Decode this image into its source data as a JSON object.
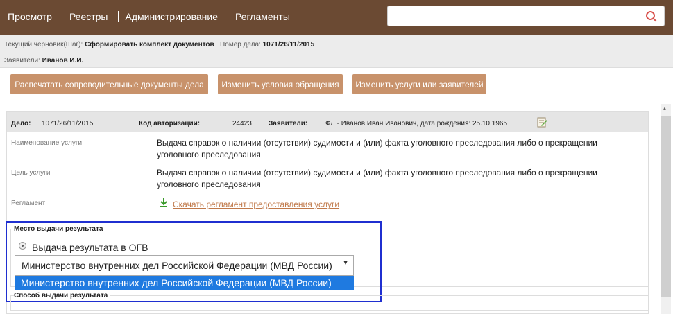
{
  "nav": {
    "items": [
      "Просмотр",
      "Реестры",
      "Администрирование",
      "Регламенты"
    ]
  },
  "search": {
    "placeholder": ""
  },
  "info": {
    "draft_label": "Текущий черновик(Шаг):",
    "draft_value": "Сформировать комплект документов",
    "case_label": "Номер дела:",
    "case_value": "1071/26/11/2015",
    "applicants_label": "Заявители:",
    "applicants_value": "Иванов И.И."
  },
  "actions": {
    "print": "Распечатать сопроводительные документы дела",
    "change_conditions": "Изменить условия обращения",
    "change_services": "Изменить услуги или заявителей"
  },
  "case": {
    "case_label": "Дело:",
    "case_value": "1071/26/11/2015",
    "auth_label": "Код авторизации:",
    "auth_value": "24423",
    "applicants_label": "Заявители:",
    "applicants_value": "ФЛ - Иванов Иван Иванович, дата рождения: 25.10.1965"
  },
  "details": {
    "service_name_label": "Наименование услуги",
    "service_name_value": "Выдача справок о наличии (отсутствии) судимости и (или) факта уголовного преследования либо о прекращении уголовного преследования",
    "purpose_label": "Цель услуги",
    "purpose_value": "Выдача справок о наличии (отсутствии) судимости и (или) факта уголовного преследования либо о прекращении уголовного преследования",
    "regulation_label": "Регламент",
    "regulation_link": "Скачать регламент предоставления услуги"
  },
  "result": {
    "legend": "Место выдачи результата",
    "radio_label": "Выдача результата в ОГВ",
    "selected": "Министерство внутренних дел Российской Федерации (МВД России)",
    "option": "Министерство внутренних дел Российской Федерации (МВД России)",
    "method_legend": "Способ выдачи результата"
  },
  "colors": {
    "topbar": "#6b4a33",
    "button": "#c8926b",
    "link": "#c0794a",
    "selection": "#1f7ae0",
    "highlight": "#1f2fd0"
  }
}
